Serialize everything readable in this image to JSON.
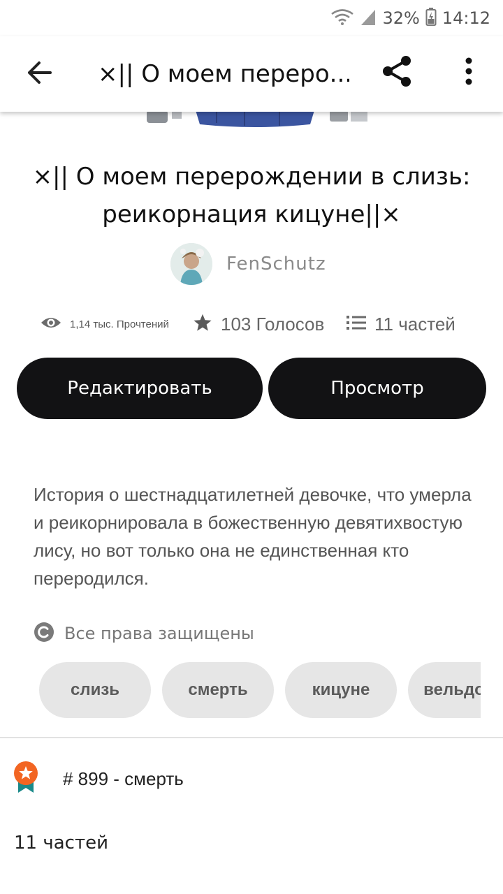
{
  "status_bar": {
    "battery_percent": "32%",
    "time": "14:12",
    "icons": [
      "wifi-icon",
      "signal-icon",
      "battery-icon"
    ]
  },
  "toolbar": {
    "title": "×|| О моем переро...",
    "icons": [
      "back-arrow-icon",
      "share-icon",
      "more-vert-icon"
    ]
  },
  "story": {
    "title": "×|| О моем перерождении в слизь: реикорнация кицуне||×",
    "author": "FenSchutz",
    "stats": {
      "reads": "1,14 тыс. Прочтений",
      "votes": "103 Голосов",
      "parts": "11 частей"
    },
    "buttons": {
      "edit": "Редактировать",
      "view": "Просмотр"
    },
    "description": "История о шестнадцатилетней девочке, что умерла и реикорнировала в божественную девятихвостую лису, но вот только она не единственная кто переродился.",
    "copyright": "Все права защищены",
    "tags": [
      "слизь",
      "смерть",
      "кицуне",
      "вельдора"
    ],
    "rank": "# 899 - смерть",
    "parts_heading": "11 частей"
  },
  "colors": {
    "button_bg": "#121214",
    "tag_bg": "#e6e6e6",
    "badge_orange": "#f26522",
    "badge_teal": "#1a8a8a",
    "muted_text": "#6b6b6b"
  }
}
